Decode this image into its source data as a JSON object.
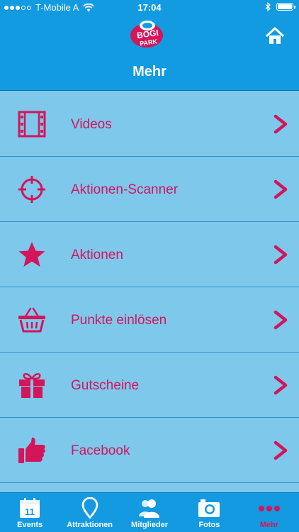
{
  "status_bar": {
    "carrier": "T-Mobile A",
    "time": "17:04"
  },
  "header": {
    "title": "Mehr",
    "logo_text": "BOGI PARK"
  },
  "colors": {
    "header_blue": "#129be0",
    "list_background": "#7ec8ec",
    "accent_pink": "#d4155a",
    "separator": "#2f8fcf"
  },
  "menu": {
    "items": [
      {
        "label": "Videos",
        "icon": "film-icon"
      },
      {
        "label": "Aktionen-Scanner",
        "icon": "crosshair-icon"
      },
      {
        "label": "Aktionen",
        "icon": "star-icon"
      },
      {
        "label": "Punkte einlösen",
        "icon": "basket-icon"
      },
      {
        "label": "Gutscheine",
        "icon": "gift-icon"
      },
      {
        "label": "Facebook",
        "icon": "thumbs-up-icon"
      }
    ]
  },
  "tabbar": {
    "tabs": [
      {
        "label": "Events",
        "icon": "calendar-icon",
        "calendar_day": "11",
        "active": false
      },
      {
        "label": "Attraktionen",
        "icon": "location-pin-icon",
        "active": false
      },
      {
        "label": "Mitglieder",
        "icon": "members-icon",
        "active": false
      },
      {
        "label": "Fotos",
        "icon": "camera-icon",
        "active": false
      },
      {
        "label": "Mehr",
        "icon": "more-dots-icon",
        "active": true
      }
    ]
  }
}
